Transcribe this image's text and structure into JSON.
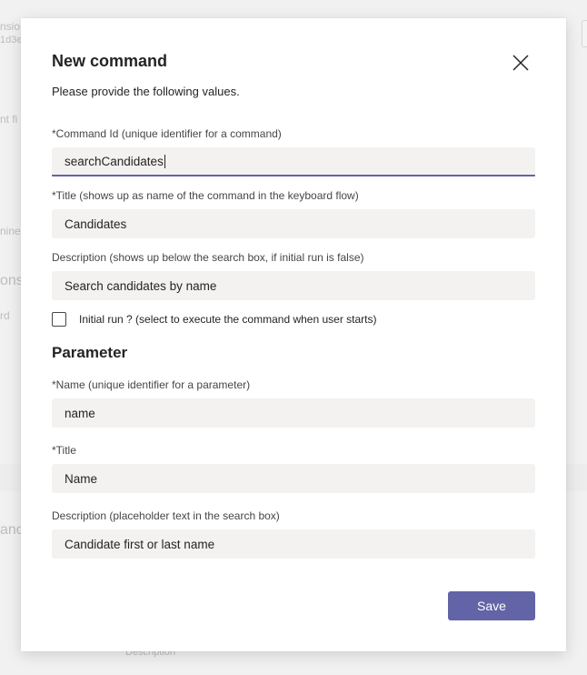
{
  "background": {
    "fragments": [
      "nsio",
      "1d3e",
      "nt fi",
      "nine",
      "ons",
      "rd",
      "andi",
      "Description"
    ]
  },
  "dialog": {
    "title": "New command",
    "subtitle": "Please provide the following values.",
    "command_id": {
      "label": "*Command Id (unique identifier for a command)",
      "value": "searchCandidates"
    },
    "title_field": {
      "label": "*Title (shows up as name of the command in the keyboard flow)",
      "value": "Candidates"
    },
    "description": {
      "label": "Description (shows up below the search box, if initial run is false)",
      "value": "Search candidates by name"
    },
    "initial_run": {
      "label": "Initial run ? (select to execute the command when user starts)",
      "checked": false
    },
    "parameter": {
      "heading": "Parameter",
      "name": {
        "label": "*Name (unique identifier for a parameter)",
        "value": "name"
      },
      "title": {
        "label": "*Title",
        "value": "Name"
      },
      "description": {
        "label": "Description (placeholder text in the search box)",
        "value": "Candidate first or last name"
      }
    },
    "save_label": "Save"
  },
  "colors": {
    "accent": "#6264a7",
    "field_background": "#f3f2f1"
  }
}
